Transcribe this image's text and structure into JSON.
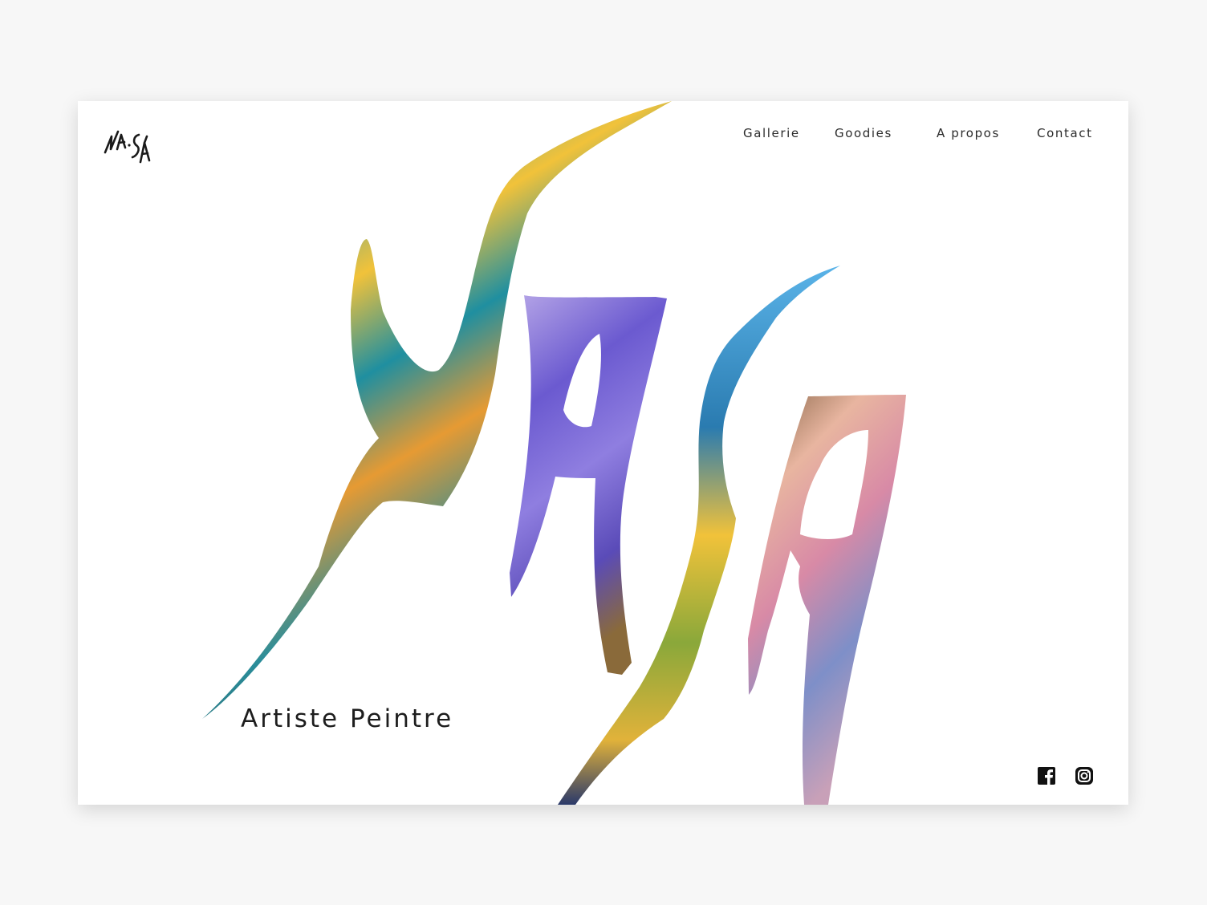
{
  "brand": {
    "logo_text": "NA·SA"
  },
  "nav": {
    "items": [
      {
        "label": "Gallerie"
      },
      {
        "label": "Goodies"
      },
      {
        "label": "A propos"
      },
      {
        "label": "Contact"
      }
    ]
  },
  "hero": {
    "wordmark": "NASA",
    "tagline": "Artiste Peintre"
  },
  "social": {
    "icons": [
      "facebook-icon",
      "instagram-icon"
    ]
  },
  "colors": {
    "page_bg": "#f7f7f7",
    "frame_bg": "#ffffff",
    "text": "#1d1d1d",
    "paint_orange": "#e8823a",
    "paint_teal": "#2f9fb1",
    "paint_yellow": "#f1c23a",
    "paint_purple": "#7d6ad6",
    "paint_pink": "#e4a4b4",
    "paint_blue": "#5ab3e8"
  }
}
